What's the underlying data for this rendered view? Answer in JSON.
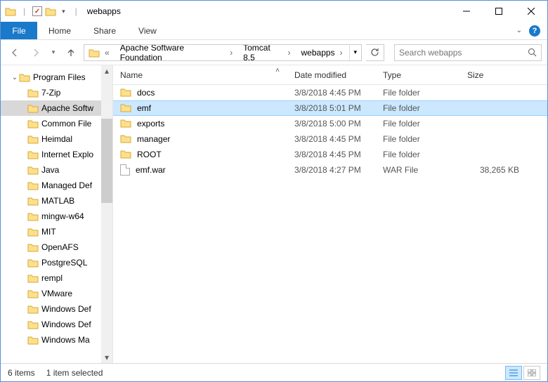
{
  "window": {
    "title": "webapps"
  },
  "qat": {
    "checkmark": "✓"
  },
  "ribbon": {
    "file": "File",
    "tabs": [
      "Home",
      "Share",
      "View"
    ]
  },
  "breadcrumb": {
    "segments": [
      "Apache Software Foundation",
      "Tomcat 8.5",
      "webapps"
    ]
  },
  "search": {
    "placeholder": "Search webapps"
  },
  "tree": {
    "root": {
      "label": "Program Files",
      "expanded": true
    },
    "children": [
      {
        "label": "7-Zip"
      },
      {
        "label": "Apache Softw",
        "selected": true
      },
      {
        "label": "Common File"
      },
      {
        "label": "Heimdal"
      },
      {
        "label": "Internet Explo"
      },
      {
        "label": "Java"
      },
      {
        "label": "Managed Def"
      },
      {
        "label": "MATLAB"
      },
      {
        "label": "mingw-w64"
      },
      {
        "label": "MIT"
      },
      {
        "label": "OpenAFS"
      },
      {
        "label": "PostgreSQL"
      },
      {
        "label": "rempl"
      },
      {
        "label": "VMware"
      },
      {
        "label": "Windows Def"
      },
      {
        "label": "Windows Def"
      },
      {
        "label": "Windows Ma"
      }
    ]
  },
  "columns": {
    "name": "Name",
    "date": "Date modified",
    "type": "Type",
    "size": "Size"
  },
  "rows": [
    {
      "name": "docs",
      "date": "3/8/2018 4:45 PM",
      "type": "File folder",
      "size": "",
      "icon": "folder"
    },
    {
      "name": "emf",
      "date": "3/8/2018 5:01 PM",
      "type": "File folder",
      "size": "",
      "icon": "folder",
      "selected": true
    },
    {
      "name": "exports",
      "date": "3/8/2018 5:00 PM",
      "type": "File folder",
      "size": "",
      "icon": "folder"
    },
    {
      "name": "manager",
      "date": "3/8/2018 4:45 PM",
      "type": "File folder",
      "size": "",
      "icon": "folder"
    },
    {
      "name": "ROOT",
      "date": "3/8/2018 4:45 PM",
      "type": "File folder",
      "size": "",
      "icon": "folder"
    },
    {
      "name": "emf.war",
      "date": "3/8/2018 4:27 PM",
      "type": "WAR File",
      "size": "38,265 KB",
      "icon": "file"
    }
  ],
  "status": {
    "count": "6 items",
    "selection": "1 item selected"
  }
}
